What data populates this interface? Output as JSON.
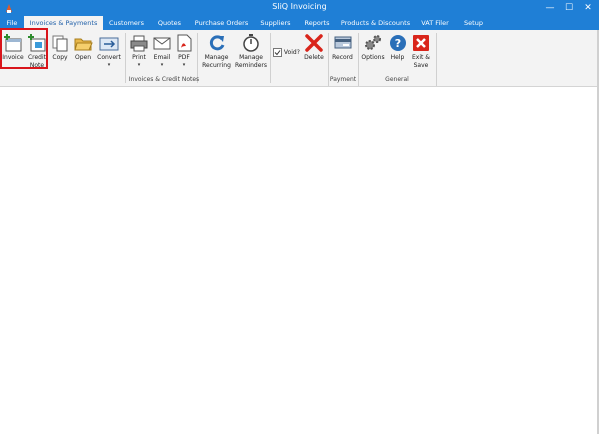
{
  "window": {
    "title": "SliQ Invoicing",
    "controls": {
      "minimize": "—",
      "maximize": "☐",
      "close": "✕"
    }
  },
  "menu": {
    "tabs": [
      "File",
      "Invoices & Payments",
      "Customers",
      "Quotes",
      "Purchase Orders",
      "Suppliers",
      "Reports",
      "Products & Discounts",
      "VAT Filer",
      "Setup"
    ],
    "active_tab": "Invoices & Payments"
  },
  "ribbon": {
    "invoices_group": {
      "label": "Invoices & Credit Notes",
      "buttons": {
        "invoice": "Invoice",
        "credit_note": "Credit\nNote",
        "copy": "Copy",
        "open": "Open",
        "convert": "Convert",
        "print": "Print",
        "email": "Email",
        "pdf": "PDF",
        "manage_recurring": "Manage\nRecurring",
        "manage_reminders": "Manage\nReminders",
        "void": "Void?",
        "delete": "Delete"
      },
      "dropdown_caret": "▾"
    },
    "payment_group": {
      "label": "Payment",
      "buttons": {
        "record": "Record"
      }
    },
    "general_group": {
      "label": "General",
      "buttons": {
        "options": "Options",
        "help": "Help",
        "exit_save": "Exit &\nSave"
      }
    }
  },
  "colors": {
    "accent": "#1f7fd6",
    "ribbon_bg": "#f3f3f3",
    "highlight": "#d9151b"
  }
}
